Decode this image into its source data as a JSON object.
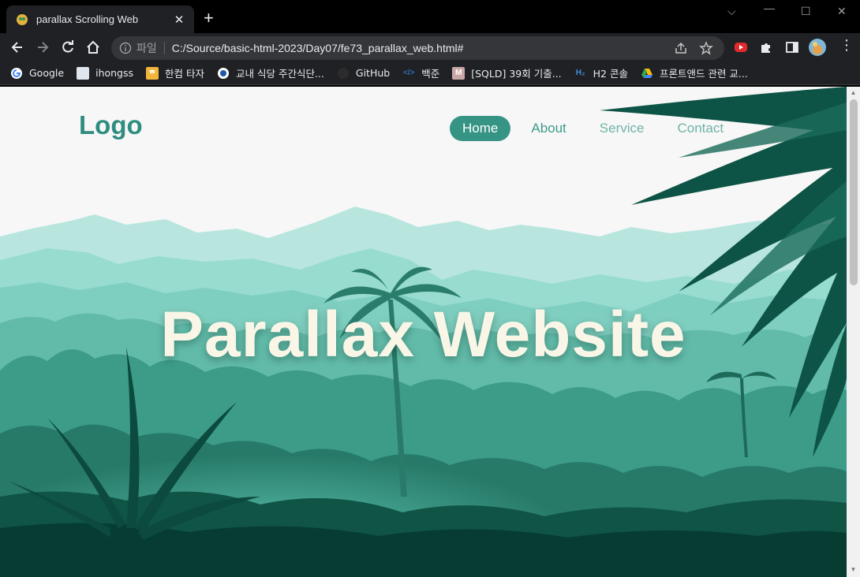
{
  "browser": {
    "tab_title": "parallax Scrolling Web",
    "url_scheme_label": "파일",
    "url": "C:/Source/basic-html-2023/Day07/fe73_parallax_web.html#",
    "bookmarks": [
      {
        "label": "Google",
        "icon": "google-icon",
        "color": "#ffffff"
      },
      {
        "label": "ihongss",
        "icon": "page-icon",
        "color": "#dfe6ee"
      },
      {
        "label": "한컴 타자",
        "icon": "hancom-icon",
        "color": "#f2b53b"
      },
      {
        "label": "교내 식당 주간식단...",
        "icon": "school-icon",
        "color": "#ffffff"
      },
      {
        "label": "GitHub",
        "icon": "github-icon",
        "color": "#202124"
      },
      {
        "label": "백준",
        "icon": "code-icon",
        "color": "#2f6fb8"
      },
      {
        "label": "[SQLD] 39회 기출...",
        "icon": "m-icon",
        "color": "#c9a7a7"
      },
      {
        "label": "H2 콘솔",
        "icon": "h2-icon",
        "color": "#1f5aa5"
      },
      {
        "label": "프론트앤드 관련 교...",
        "icon": "drive-icon",
        "color": "#34a853"
      }
    ]
  },
  "page": {
    "logo": "Logo",
    "nav": [
      {
        "label": "Home",
        "active": true
      },
      {
        "label": "About",
        "active": false
      },
      {
        "label": "Service",
        "active": false
      },
      {
        "label": "Contact",
        "active": false
      }
    ],
    "hero_title": "Parallax Website"
  },
  "colors": {
    "accent": "#359483",
    "sky": "#f7f7f7",
    "mountain_far": "#b3e4dd",
    "forest_dark": "#063c31"
  }
}
